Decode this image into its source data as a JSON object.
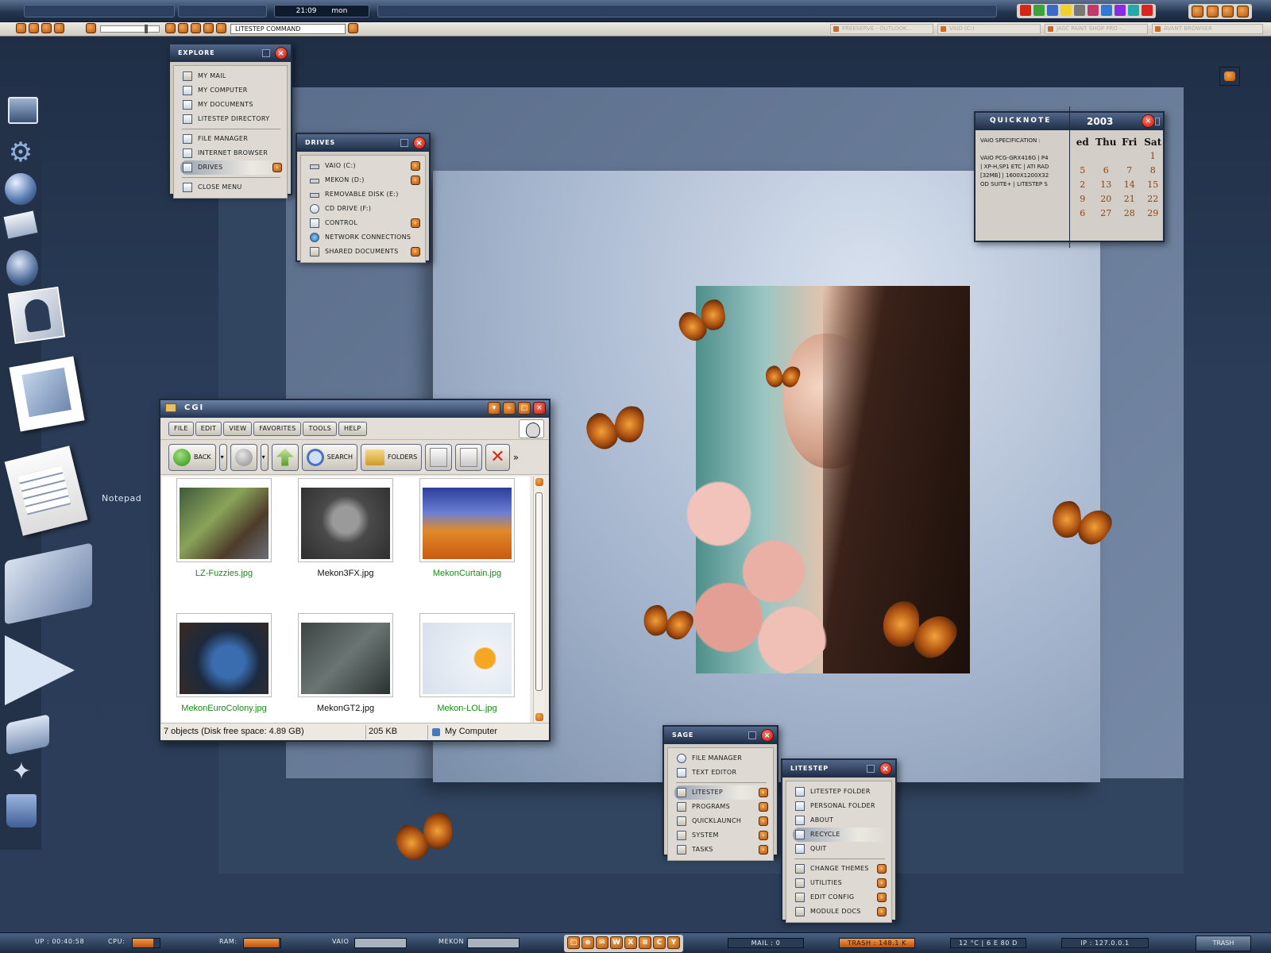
{
  "topbar": {
    "time": "21:09",
    "day": "mon"
  },
  "commandbar": {
    "command_placeholder": "LITESTEP COMMAND",
    "tasks": [
      {
        "label": "FREESERVE - OUTLOOK..."
      },
      {
        "label": "VAIO (C:)"
      },
      {
        "label": "JASC PAINT SHOP PRO -..."
      },
      {
        "label": "AVANT BROWSER"
      }
    ]
  },
  "explore_menu": {
    "title": "EXPLORE",
    "items": [
      {
        "label": "MY MAIL"
      },
      {
        "label": "MY COMPUTER"
      },
      {
        "label": "MY DOCUMENTS"
      },
      {
        "label": "LITESTEP DIRECTORY"
      },
      {
        "label": "FILE MANAGER"
      },
      {
        "label": "INTERNET BROWSER"
      },
      {
        "label": "DRIVES"
      },
      {
        "label": "CLOSE MENU"
      }
    ]
  },
  "drives_menu": {
    "title": "DRIVES",
    "items": [
      {
        "label": "VAIO (C:)"
      },
      {
        "label": "MEKON (D:)"
      },
      {
        "label": "REMOVABLE DISK (E:)"
      },
      {
        "label": "CD DRIVE (F:)"
      },
      {
        "label": "CONTROL"
      },
      {
        "label": "NETWORK CONNECTIONS"
      },
      {
        "label": "SHARED DOCUMENTS"
      }
    ]
  },
  "quicknote": {
    "title": "QUICKNOTE",
    "year": "2003",
    "lines": [
      "VAIO SPECIFICATION :",
      "",
      "VAIO PCG-GRX416G | P4",
      "| XP-H,SP1 ETC | ATI RAD",
      "[32MB] | 1600X1200X32",
      "OD SUITE+ | LITESTEP S"
    ],
    "calendar": {
      "headers": [
        "ed",
        "Thu",
        "Fri",
        "Sat"
      ],
      "rows": [
        [
          "",
          "",
          "",
          "1"
        ],
        [
          "5",
          "6",
          "7",
          "8"
        ],
        [
          "2",
          "13",
          "14",
          "15"
        ],
        [
          "9",
          "20",
          "21",
          "22"
        ],
        [
          "6",
          "27",
          "28",
          "29"
        ]
      ]
    }
  },
  "notepad_label": "Notepad",
  "explorer": {
    "title": "CGI",
    "menus": [
      "FILE",
      "EDIT",
      "VIEW",
      "FAVORITES",
      "TOOLS",
      "HELP"
    ],
    "back_label": "BACK",
    "search_label": "SEARCH",
    "folders_label": "FOLDERS",
    "files": [
      {
        "name": "LZ-Fuzzies.jpg",
        "green": true
      },
      {
        "name": "Mekon3FX.jpg",
        "green": false
      },
      {
        "name": "MekonCurtain.jpg",
        "green": true
      },
      {
        "name": "MekonEuroColony.jpg",
        "green": true
      },
      {
        "name": "MekonGT2.jpg",
        "green": false
      },
      {
        "name": "Mekon-LOL.jpg",
        "green": true
      }
    ],
    "status_objects": "7 objects (Disk free space: 4.89 GB)",
    "status_size": "205 KB",
    "status_location": "My Computer"
  },
  "sage_menu": {
    "title": "SAGE",
    "items": [
      {
        "label": "FILE MANAGER"
      },
      {
        "label": "TEXT EDITOR"
      },
      {
        "label": "LITESTEP"
      },
      {
        "label": "PROGRAMS"
      },
      {
        "label": "QUICKLAUNCH"
      },
      {
        "label": "SYSTEM"
      },
      {
        "label": "TASKS"
      }
    ]
  },
  "litestep_menu": {
    "title": "LITESTEP",
    "items": [
      {
        "label": "LITESTEP FOLDER"
      },
      {
        "label": "PERSONAL FOLDER"
      },
      {
        "label": "ABOUT"
      },
      {
        "label": "RECYCLE"
      },
      {
        "label": "QUIT"
      },
      {
        "label": "CHANGE THEMES"
      },
      {
        "label": "UTILITIES"
      },
      {
        "label": "EDIT CONFIG"
      },
      {
        "label": "MODULE DOCS"
      }
    ]
  },
  "bottombar": {
    "uptime": "UP : 00:40:58",
    "cpu_label": "CPU:",
    "cpu_level": 0.75,
    "ram_label": "RAM:",
    "ram_level": 0.95,
    "vaio_label": "VAIO",
    "mekon_label": "MEKON",
    "quicklaunch": [
      "□",
      "e",
      "✉",
      "W",
      "X",
      "≡",
      "C",
      "Y"
    ],
    "mail": "MAIL : 0",
    "trash": "TRASH : 148.1 K",
    "weather": "12 °C | 6   E 80 D",
    "ip": "IP : 127.0.0.1",
    "trashcan_label": "TRASH"
  }
}
